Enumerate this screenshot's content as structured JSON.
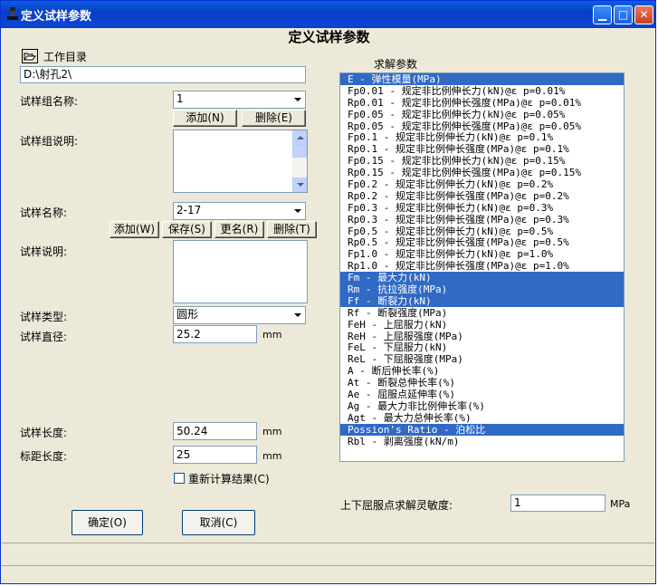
{
  "window": {
    "title": "定义试样参数"
  },
  "heading": "定义试样参数",
  "workdir": {
    "label": "工作目录",
    "path": "D:\\射孔2\\"
  },
  "group": {
    "name_label": "试样组名称:",
    "name_value": "1",
    "add_label": "添加(N)",
    "delete_label": "删除(E)",
    "desc_label": "试样组说明:"
  },
  "sample": {
    "name_label": "试样名称:",
    "name_value": "2-17",
    "add_label": "添加(W)",
    "save_label": "保存(S)",
    "rename_label": "更名(R)",
    "delete_label": "删除(T)",
    "desc_label": "试样说明:",
    "type_label": "试样类型:",
    "type_value": "圆形",
    "diameter_label": "试样直径:",
    "diameter_value": "25.2",
    "diameter_unit": "mm",
    "length_label": "试样长度:",
    "length_value": "50.24",
    "length_unit": "mm",
    "gauge_label": "标距长度:",
    "gauge_value": "25",
    "gauge_unit": "mm"
  },
  "recalc_label": "重新计算结果(C)",
  "ok_label": "确定(O)",
  "cancel_label": "取消(C)",
  "params": {
    "label": "求解参数",
    "items": [
      {
        "text": "E - 弹性模量(MPa)",
        "selected": true
      },
      {
        "text": "Fp0.01 - 规定非比例伸长力(kN)@ε p=0.01%",
        "selected": false
      },
      {
        "text": "Rp0.01 - 规定非比例伸长强度(MPa)@ε p=0.01%",
        "selected": false
      },
      {
        "text": "Fp0.05 - 规定非比例伸长力(kN)@ε p=0.05%",
        "selected": false
      },
      {
        "text": "Rp0.05 - 规定非比例伸长强度(MPa)@ε p=0.05%",
        "selected": false
      },
      {
        "text": "Fp0.1 - 规定非比例伸长力(kN)@ε p=0.1%",
        "selected": false
      },
      {
        "text": "Rp0.1 - 规定非比例伸长强度(MPa)@ε p=0.1%",
        "selected": false
      },
      {
        "text": "Fp0.15 - 规定非比例伸长力(kN)@ε p=0.15%",
        "selected": false
      },
      {
        "text": "Rp0.15 - 规定非比例伸长强度(MPa)@ε p=0.15%",
        "selected": false
      },
      {
        "text": "Fp0.2 - 规定非比例伸长力(kN)@ε p=0.2%",
        "selected": false
      },
      {
        "text": "Rp0.2 - 规定非比例伸长强度(MPa)@ε p=0.2%",
        "selected": false
      },
      {
        "text": "Fp0.3 - 规定非比例伸长力(kN)@ε p=0.3%",
        "selected": false
      },
      {
        "text": "Rp0.3 - 规定非比例伸长强度(MPa)@ε p=0.3%",
        "selected": false
      },
      {
        "text": "Fp0.5 - 规定非比例伸长力(kN)@ε p=0.5%",
        "selected": false
      },
      {
        "text": "Rp0.5 - 规定非比例伸长强度(MPa)@ε p=0.5%",
        "selected": false
      },
      {
        "text": "Fp1.0 - 规定非比例伸长力(kN)@ε p=1.0%",
        "selected": false
      },
      {
        "text": "Rp1.0 - 规定非比例伸长强度(MPa)@ε p=1.0%",
        "selected": false
      },
      {
        "text": "Fm - 最大力(kN)",
        "selected": true
      },
      {
        "text": "Rm - 抗拉强度(MPa)",
        "selected": true
      },
      {
        "text": "Ff - 断裂力(kN)",
        "selected": true
      },
      {
        "text": "Rf - 断裂强度(MPa)",
        "selected": false
      },
      {
        "text": "FeH - 上屈服力(kN)",
        "selected": false
      },
      {
        "text": "ReH - 上屈服强度(MPa)",
        "selected": false
      },
      {
        "text": "FeL - 下屈服力(kN)",
        "selected": false
      },
      {
        "text": "ReL - 下屈服强度(MPa)",
        "selected": false
      },
      {
        "text": "A - 断后伸长率(%)",
        "selected": false
      },
      {
        "text": "At - 断裂总伸长率(%)",
        "selected": false
      },
      {
        "text": "Ae - 屈服点延伸率(%)",
        "selected": false
      },
      {
        "text": "Ag - 最大力非比例伸长率(%)",
        "selected": false
      },
      {
        "text": "Agt - 最大力总伸长率(%)",
        "selected": false
      },
      {
        "text": "Possion's Ratio - 泊松比",
        "selected": true
      },
      {
        "text": "Rbl - 剥离强度(kN/m)",
        "selected": false
      }
    ]
  },
  "sensitivity": {
    "label": "上下屈服点求解灵敏度:",
    "value": "1",
    "unit": "MPa"
  },
  "icons": {
    "app": "stamp-icon",
    "folder": "folder-open-icon"
  },
  "colors": {
    "selection": "#316ac5",
    "titlebar": "#0a3ec4",
    "dialog": "#ece9d8"
  }
}
